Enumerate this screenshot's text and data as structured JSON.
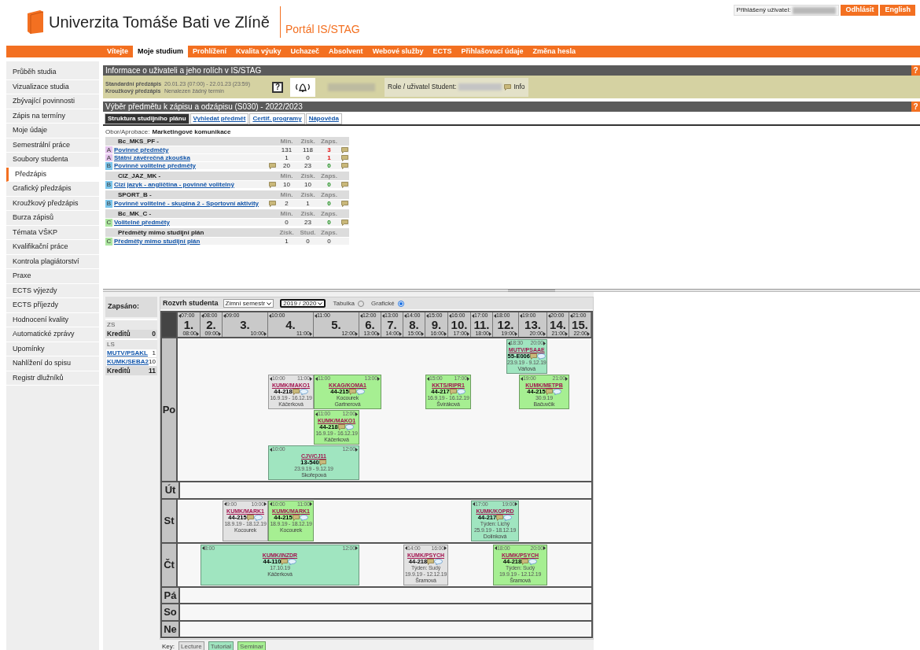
{
  "header": {
    "university": "Univerzita Tomáše Bati ve Zlíně",
    "portal": "Portál IS/STAG",
    "user_label": "Přihlášený uživatel:",
    "buttons": [
      "Odhlásit",
      "English"
    ]
  },
  "nav": [
    {
      "label": "Vítejte",
      "selected": false
    },
    {
      "label": "Moje studium",
      "selected": true
    },
    {
      "label": "Prohlížení",
      "selected": false
    },
    {
      "label": "Kvalita výuky",
      "selected": false
    },
    {
      "label": "Uchazeč",
      "selected": false
    },
    {
      "label": "Absolvent",
      "selected": false
    },
    {
      "label": "Webové služby",
      "selected": false
    },
    {
      "label": "ECTS",
      "selected": false
    },
    {
      "label": "Přihlašovací údaje",
      "selected": false
    },
    {
      "label": "Změna hesla",
      "selected": false
    }
  ],
  "sidebar": [
    {
      "label": "Průběh studia",
      "selected": false
    },
    {
      "label": "Vizualizace studia",
      "selected": false
    },
    {
      "label": "Zbývající povinnosti",
      "selected": false
    },
    {
      "label": "Zápis na termíny",
      "selected": false
    },
    {
      "label": "Moje údaje",
      "selected": false
    },
    {
      "label": "Semestrální práce",
      "selected": false
    },
    {
      "label": "Soubory studenta",
      "selected": false
    },
    {
      "label": "Předzápis",
      "selected": true
    },
    {
      "label": "Grafický předzápis",
      "selected": false
    },
    {
      "label": "Kroužkový předzápis",
      "selected": false
    },
    {
      "label": "Burza zápisů",
      "selected": false
    },
    {
      "label": "Témata VŠKP",
      "selected": false
    },
    {
      "label": "Kvalifikační práce",
      "selected": false
    },
    {
      "label": "Kontrola plagiátorství",
      "selected": false
    },
    {
      "label": "Praxe",
      "selected": false
    },
    {
      "label": "ECTS výjezdy",
      "selected": false
    },
    {
      "label": "ECTS příjezdy",
      "selected": false
    },
    {
      "label": "Hodnocení kvality",
      "selected": false
    },
    {
      "label": "Automatické zprávy",
      "selected": false
    },
    {
      "label": "Upomínky",
      "selected": false
    },
    {
      "label": "Nahlížení do spisu",
      "selected": false
    },
    {
      "label": "Registr dlužníků",
      "selected": false
    }
  ],
  "info": {
    "title": "Informace o uživateli a jeho rolích v IS/STAG",
    "help": "?",
    "rows": [
      {
        "label": "Standardní předzápis",
        "value": "20.01.23 (07:00) - 22.01.23 (23:59)"
      },
      {
        "label": "Kroužkový předzápis",
        "value": "Nenalezen žádný termín"
      }
    ],
    "help_button": "?",
    "role_label": "Role / uživatel Student:",
    "info_link": "Info"
  },
  "selection": {
    "title": "Výběr předmětu k zápisu a odzápisu (S030) - 2022/2023",
    "help": "?",
    "tabs": [
      {
        "label": "Struktura studijního plánu",
        "selected": true
      },
      {
        "label": "Vyhledat předmět",
        "selected": false
      },
      {
        "label": "Certif. programy",
        "selected": false
      },
      {
        "label": "Nápověda",
        "selected": false
      }
    ],
    "field_label": "Obor/Aprobace:",
    "field_value": "Marketingové komunikace",
    "groups": [
      {
        "name": "Bc_MKS_PF -",
        "columns": [
          "Min.",
          "Získ.",
          "Zaps."
        ],
        "rows": [
          {
            "letter": "A",
            "color": "#e6c6ee",
            "label": "Povinné předměty",
            "note": false,
            "values": [
              "131",
              "118"
            ],
            "enrolled": {
              "value": "3",
              "kind": "missing"
            },
            "comment": true
          },
          {
            "letter": "A",
            "color": "#e6c6ee",
            "label": "Státní závěrečná zkouška",
            "note": false,
            "values": [
              "1",
              "0"
            ],
            "enrolled": {
              "value": "1",
              "kind": "missing"
            },
            "comment": true
          },
          {
            "letter": "B",
            "color": "#7cc6ec",
            "label": "Povinně volitelné předměty",
            "note": true,
            "values": [
              "20",
              "23"
            ],
            "enrolled": {
              "value": "0",
              "kind": "ok"
            },
            "comment": true
          }
        ]
      },
      {
        "name": "CIZ_JAZ_MK -",
        "columns": [
          "Min.",
          "Získ.",
          "Zaps."
        ],
        "rows": [
          {
            "letter": "B",
            "color": "#7cc6ec",
            "label": "Cizí jazyk - angličtina - povinně volitelný",
            "note": true,
            "values": [
              "10",
              "10"
            ],
            "enrolled": {
              "value": "0",
              "kind": "ok"
            },
            "comment": true
          }
        ]
      },
      {
        "name": "SPORT_B -",
        "columns": [
          "Min.",
          "Získ.",
          "Zaps."
        ],
        "rows": [
          {
            "letter": "B",
            "color": "#7cc6ec",
            "label": "Povinně volitelné - skupina 2 - Sportovní aktivity",
            "note": true,
            "values": [
              "2",
              "1"
            ],
            "enrolled": {
              "value": "0",
              "kind": "ok"
            },
            "comment": true
          }
        ]
      },
      {
        "name": "Bc_MK_C -",
        "columns": [
          "Min.",
          "Získ.",
          "Zaps."
        ],
        "rows": [
          {
            "letter": "C",
            "color": "#ade6a0",
            "label": "Volitelné předměty",
            "note": false,
            "values": [
              "0",
              "23"
            ],
            "enrolled": {
              "value": "0",
              "kind": "ok"
            },
            "comment": true
          }
        ]
      },
      {
        "name": "Předměty mimo studijní plán",
        "columns": [
          "Získ.",
          "Stud.",
          "Zaps."
        ],
        "rows": [
          {
            "letter": "C",
            "color": "#ade6a0",
            "label": "Předměty mimo studijní plán",
            "note": false,
            "values": [
              "1",
              "0"
            ],
            "enrolled": {
              "value": "0",
              "kind": "plain"
            },
            "comment": false
          }
        ]
      }
    ]
  },
  "enrolled": {
    "title": "Zapsáno:",
    "semesters": [
      {
        "name": "ZS",
        "credits_label": "Kreditů",
        "credits": "0"
      },
      {
        "name": "LS",
        "courses": [
          {
            "code": "MUTV/PSAKL",
            "credits": "1"
          },
          {
            "code": "KUMK/SEBA2",
            "credits": "10"
          }
        ],
        "credits_label": "Kreditů",
        "credits": "11"
      }
    ]
  },
  "schedule": {
    "title": "Rozvrh studenta",
    "semester": "Zimní semestr",
    "year": "2019 / 2020",
    "views": [
      {
        "label": "Tabulka",
        "selected": false
      },
      {
        "label": "Grafické",
        "selected": true
      }
    ],
    "slots": [
      {
        "number": "1.",
        "start": "07:00",
        "end": "08:00"
      },
      {
        "number": "2.",
        "start": "08:00",
        "end": "09:00"
      },
      {
        "number": "3.",
        "start": "09:00",
        "end": "10:00"
      },
      {
        "number": "4.",
        "start": "10:00",
        "end": "11:00"
      },
      {
        "number": "5.",
        "start": "11:00",
        "end": "12:00"
      },
      {
        "number": "6.",
        "start": "12:00",
        "end": "13:00"
      },
      {
        "number": "7.",
        "start": "13:00",
        "end": "14:00"
      },
      {
        "number": "8.",
        "start": "14:00",
        "end": "15:00"
      },
      {
        "number": "9.",
        "start": "15:00",
        "end": "16:00"
      },
      {
        "number": "10.",
        "start": "16:00",
        "end": "17:00"
      },
      {
        "number": "11.",
        "start": "17:00",
        "end": "18:00"
      },
      {
        "number": "12.",
        "start": "18:00",
        "end": "19:00"
      },
      {
        "number": "13.",
        "start": "19:00",
        "end": "20:00"
      },
      {
        "number": "14.",
        "start": "20:00",
        "end": "21:00"
      },
      {
        "number": "15.",
        "start": "21:00",
        "end": "22:00"
      }
    ],
    "days": [
      {
        "name": "Po",
        "lanes": [
          [
            {
              "kind": "tutorial",
              "start": "18:30",
              "end": "20:00",
              "code": "MUTV/PSAAE",
              "room": "55-E006",
              "chat": true,
              "dates": "23.9.19 - 9.12.19",
              "teachers": [
                "Váňová"
              ]
            }
          ],
          [
            {
              "kind": "lecture",
              "start": "10:00",
              "end": "11:00",
              "code": "KUMK/MAKO1",
              "room": "44-218",
              "chat": true,
              "dates": "16.9.19 - 16.12.19",
              "teachers": [
                "Káčerková"
              ]
            },
            {
              "kind": "seminar",
              "start": "11:00",
              "end": "13:00",
              "code": "KKAG/KOMA1",
              "room": "44-215",
              "chat": true,
              "teachers": [
                "Kocourek",
                "Gartnerová"
              ]
            },
            {
              "kind": "seminar",
              "start": "15:00",
              "end": "17:00",
              "code": "KKTS/RIPR1",
              "room": "44-217",
              "chat": true,
              "dates": "16.9.19 - 16.12.19",
              "teachers": [
                "Švíráková"
              ]
            },
            {
              "kind": "seminar",
              "start": "19:00",
              "end": "21:00",
              "code": "KUMK/METPB",
              "room": "44-215",
              "chat": true,
              "dates": "30.9.19",
              "teachers": [
                "Bačuvčík"
              ]
            }
          ],
          [
            {
              "kind": "seminar",
              "start": "11:00",
              "end": "12:00",
              "code": "KUMK/MAKO1",
              "room": "44-218",
              "chat": true,
              "dates": "16.9.19 - 16.12.19",
              "teachers": [
                "Káčerková"
              ]
            }
          ],
          [
            {
              "kind": "tutorial",
              "start": "10:00",
              "end": "12:00",
              "code": "CJV/CJ11",
              "room": "13-540",
              "chat": false,
              "dates": "23.9.19 - 9.12.19",
              "teachers": [
                "Skořepová"
              ]
            }
          ]
        ]
      },
      {
        "name": "Út"
      },
      {
        "name": "St",
        "lanes": [
          [
            {
              "kind": "lecture",
              "start": "9:00",
              "end": "10:00",
              "code": "KUMK/MARK1",
              "room": "44-215",
              "chat": true,
              "dates": "18.9.19 - 18.12.19",
              "teachers": [
                "Kocourek"
              ]
            },
            {
              "kind": "seminar",
              "start": "10:00",
              "end": "11:00",
              "code": "KUMK/MARK1",
              "room": "44-215",
              "chat": true,
              "dates": "18.9.19 - 18.12.19",
              "teachers": [
                "Kocourek"
              ]
            },
            {
              "kind": "tutorial",
              "start": "17:00",
              "end": "19:00",
              "code": "KUMK/KOPRD",
              "room": "44-217",
              "chat": true,
              "week": "Týden: Lichý",
              "dates": "25.9.19 - 18.12.19",
              "teachers": [
                "Dolínková"
              ]
            }
          ]
        ]
      },
      {
        "name": "Čt",
        "lanes": [
          [
            {
              "kind": "tutorial",
              "start": "8:00",
              "end": "12:00",
              "code": "KUMK/INZDR",
              "room": "44-110",
              "chat": true,
              "dates": "17.10.19",
              "teachers": [
                "Káčerková"
              ]
            },
            {
              "kind": "lecture",
              "start": "14:00",
              "end": "16:00",
              "code": "KUMK/PSYCH",
              "room": "44-218",
              "chat": true,
              "week": "Týden: Sudý",
              "dates": "19.9.19 - 12.12.19",
              "teachers": [
                "Šramová"
              ]
            },
            {
              "kind": "seminar",
              "start": "18:00",
              "end": "20:00",
              "code": "KUMK/PSYCH",
              "room": "44-218",
              "chat": true,
              "week": "Týden: Sudý",
              "dates": "19.9.19 - 12.12.19",
              "teachers": [
                "Šramová"
              ]
            }
          ]
        ]
      },
      {
        "name": "Pá"
      },
      {
        "name": "So"
      },
      {
        "name": "Ne"
      }
    ],
    "key_label": "Key:",
    "key": [
      {
        "kind": "lecture",
        "label": "Lecture"
      },
      {
        "kind": "tutorial",
        "label": "Tutorial"
      },
      {
        "kind": "seminar",
        "label": "Seminar"
      }
    ]
  }
}
